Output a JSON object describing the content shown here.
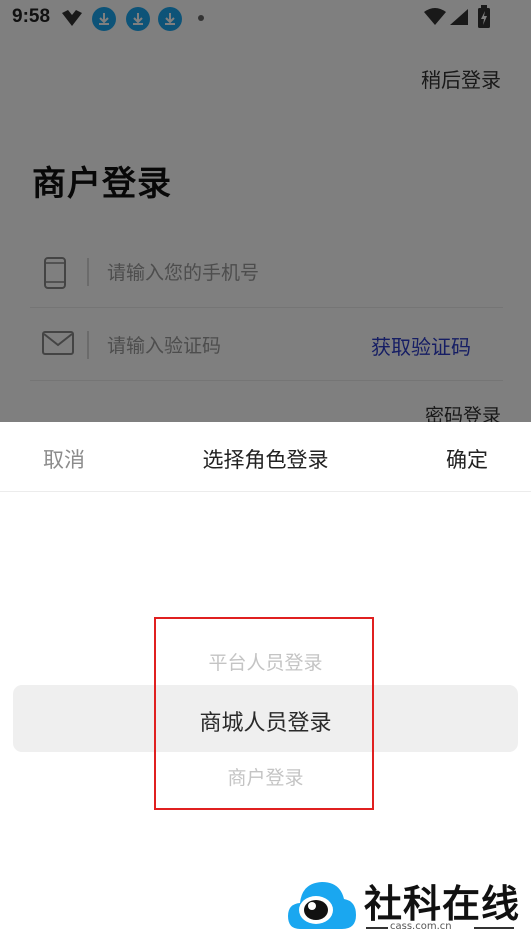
{
  "status_bar": {
    "time": "9:58",
    "icons": [
      "app-logo-icon",
      "download-icon",
      "download-icon",
      "download-icon",
      "dot-icon",
      "wifi-icon",
      "signal-icon",
      "battery-icon"
    ]
  },
  "page": {
    "later_login": "稍后登录",
    "title": "商户登录",
    "phone_placeholder": "请输入您的手机号",
    "code_placeholder": "请输入验证码",
    "get_code": "获取验证码",
    "password_login": "密码登录"
  },
  "sheet": {
    "cancel": "取消",
    "title": "选择角色登录",
    "confirm": "确定",
    "options": [
      "平台人员登录",
      "商城人员登录",
      "商户登录"
    ],
    "selected": "商城人员登录"
  },
  "watermark": {
    "text": "社科在线",
    "url": "cass.com.cn"
  },
  "colors": {
    "accent_link": "#2d3cc8",
    "highlight_box": "#e02020",
    "download_badge": "#1aa7f0"
  }
}
